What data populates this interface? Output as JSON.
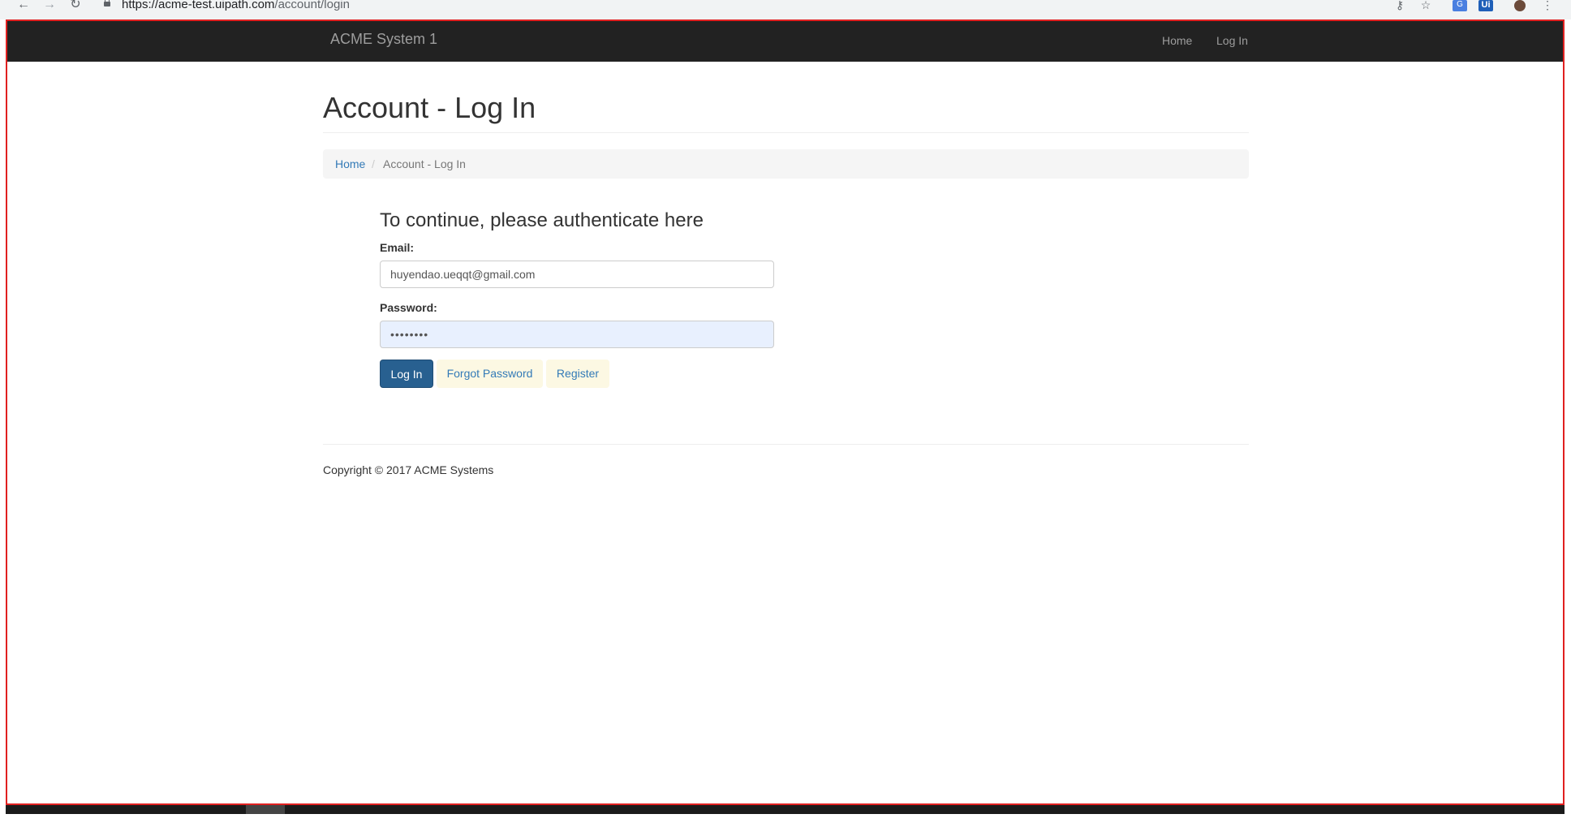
{
  "browser": {
    "url_host": "https://acme-test.uipath.com",
    "url_path": "/account/login",
    "icons": [
      "back-icon",
      "forward-icon",
      "reload-icon",
      "lock-icon",
      "key-icon",
      "star-icon",
      "translate-icon",
      "ui-extension-icon",
      "profile-avatar",
      "menu-icon"
    ],
    "ext_ui_label": "Ui"
  },
  "navbar": {
    "brand": "ACME System 1",
    "links": [
      "Home",
      "Log In"
    ]
  },
  "page": {
    "title": "Account - Log In",
    "breadcrumb": {
      "home": "Home",
      "separator": "/",
      "current": "Account - Log In"
    }
  },
  "form": {
    "heading": "To continue, please authenticate here",
    "email_label": "Email:",
    "email_value": "huyendao.ueqqt@gmail.com",
    "password_label": "Password:",
    "password_value": "••••••••",
    "login_button": "Log In",
    "forgot_link": "Forgot Password",
    "register_link": "Register"
  },
  "footer": {
    "copyright": "Copyright © 2017 ACME Systems"
  },
  "colors": {
    "navbar_bg": "#222222",
    "primary": "#286090",
    "link": "#337ab7",
    "frame_border": "#e02020",
    "autofill_bg": "#e8f0fe"
  }
}
